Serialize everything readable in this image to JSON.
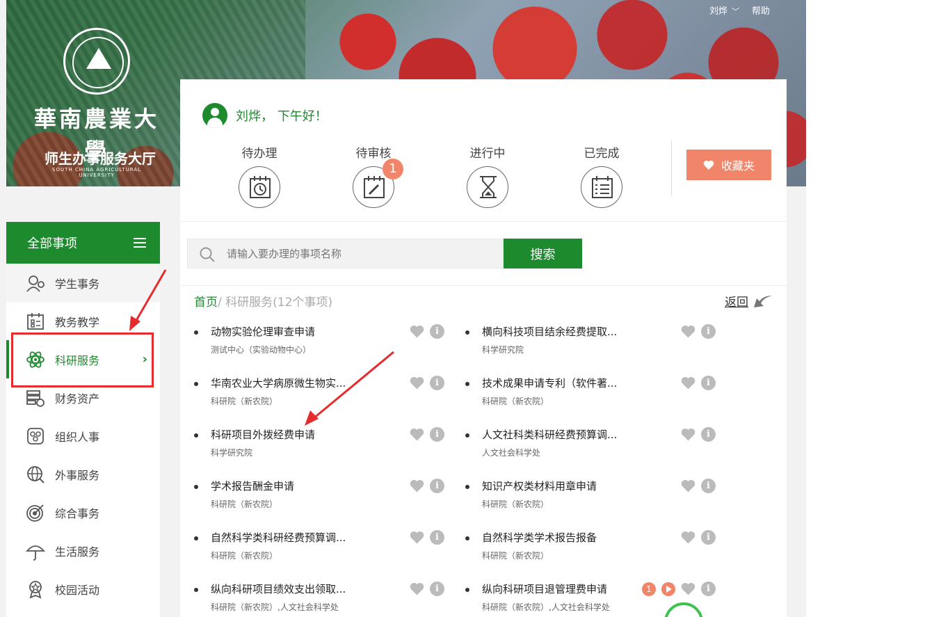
{
  "topbar": {
    "user": "刘烨",
    "help": "帮助"
  },
  "brand": {
    "name": "華南農業大學",
    "en": "SOUTH CHINA AGRICULTURAL UNIVERSITY",
    "hall": "师生办事服务大厅"
  },
  "greeting": "刘烨， 下午好！",
  "statuses": [
    {
      "label": "待办理",
      "icon": "calendar-clock-icon"
    },
    {
      "label": "待审核",
      "icon": "edit-note-icon",
      "badge": "1"
    },
    {
      "label": "进行中",
      "icon": "hourglass-icon"
    },
    {
      "label": "已完成",
      "icon": "checklist-icon"
    }
  ],
  "favorites_label": "收藏夹",
  "search": {
    "placeholder": "请输入要办理的事项名称",
    "button": "搜索"
  },
  "breadcrumb": {
    "home": "首页",
    "current": "/ 科研服务(12个事项)",
    "back": "返回"
  },
  "sidebar": {
    "header": "全部事项",
    "items": [
      {
        "label": "学生事务"
      },
      {
        "label": "教务教学"
      },
      {
        "label": "科研服务"
      },
      {
        "label": "财务资产"
      },
      {
        "label": "组织人事"
      },
      {
        "label": "外事服务"
      },
      {
        "label": "综合事务"
      },
      {
        "label": "生活服务"
      },
      {
        "label": "校园活动"
      }
    ]
  },
  "items": [
    {
      "title": "动物实验伦理审查申请",
      "org": "测试中心（实验动物中心）"
    },
    {
      "title": "横向科技项目结余经费提取...",
      "org": "科学研究院"
    },
    {
      "title": "华南农业大学病原微生物实...",
      "org": "科研院（新农院）"
    },
    {
      "title": "技术成果申请专利（软件著...",
      "org": "科研院（新农院）"
    },
    {
      "title": "科研项目外拨经费申请",
      "org": "科学研究院"
    },
    {
      "title": "人文社科类科研经费预算调...",
      "org": "人文社会科学处"
    },
    {
      "title": "学术报告酬金申请",
      "org": "科研院（新农院）"
    },
    {
      "title": "知识产权类材料用章申请",
      "org": "科研院（新农院）"
    },
    {
      "title": "自然科学类科研经费预算调...",
      "org": "科研院（新农院）"
    },
    {
      "title": "自然科学类学术报告报备",
      "org": "科研院（新农院）"
    },
    {
      "title": "纵向科研项目绩效支出领取...",
      "org": "科研院（新农院）,人文社会科学处"
    },
    {
      "title": "纵向科研项目退管理费申请",
      "org": "科研院（新农院）,人文社会科学处",
      "badge": "1"
    }
  ],
  "colors": {
    "green": "#1e8a2e",
    "coral": "#f08569",
    "highlight_red": "#e52b2b"
  }
}
